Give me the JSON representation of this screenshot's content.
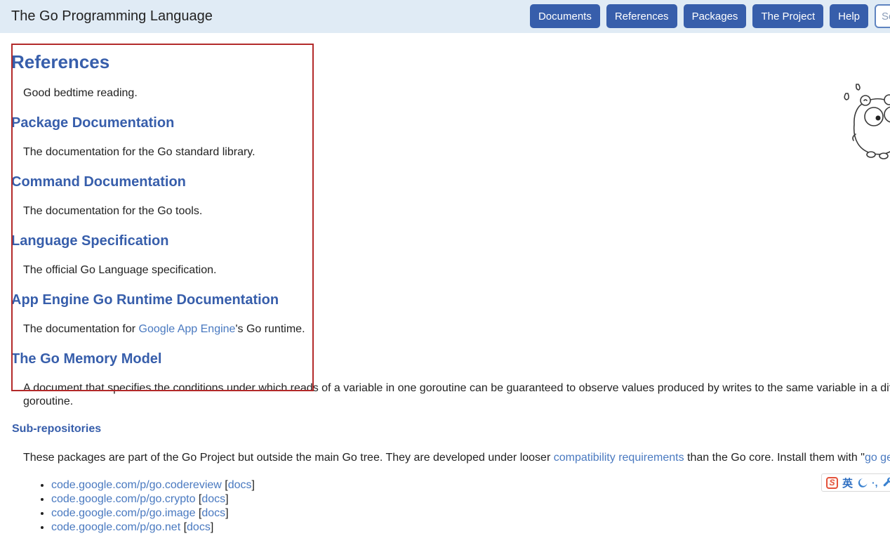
{
  "colors": {
    "accent_blue": "#375eab",
    "header_background": "#e0ebf5",
    "inline_link_blue": "#4979c0",
    "annotation_red": "#b32a2a",
    "ime_orange": "#e4533c",
    "ime_blue": "#2f6fc2"
  },
  "header": {
    "title": "The Go Programming Language",
    "nav": [
      {
        "label": "Documents"
      },
      {
        "label": "References"
      },
      {
        "label": "Packages"
      },
      {
        "label": "The Project"
      },
      {
        "label": "Help"
      }
    ],
    "search_placeholder": "Search"
  },
  "page": {
    "title": "References",
    "intro": "Good bedtime reading.",
    "sections": [
      {
        "heading": "Package Documentation",
        "desc": "The documentation for the Go standard library."
      },
      {
        "heading": "Command Documentation",
        "desc": "The documentation for the Go tools."
      },
      {
        "heading": "Language Specification",
        "desc": "The official Go Language specification."
      },
      {
        "heading": "App Engine Go Runtime Documentation",
        "desc_prefix": "The documentation for ",
        "desc_link": "Google App Engine",
        "desc_suffix": "'s Go runtime."
      },
      {
        "heading": "The Go Memory Model",
        "desc_line1": "A document that specifies the conditions under which reads of a variable in one goroutine can be guaranteed to observe values produced by writes to the same variable in a different",
        "desc_line2": "goroutine."
      }
    ],
    "subrepos": {
      "heading": "Sub-repositories",
      "intro_prefix": "These packages are part of the Go Project but outside the main Go tree. They are developed under looser ",
      "compat_link": "compatibility requirements",
      "intro_mid": " than the Go core. Install them with \"",
      "goget_link": "go get",
      "intro_suffix": "\".",
      "bracket_open": " [",
      "docs_label": "docs",
      "bracket_close": "]",
      "items": [
        {
          "url": "code.google.com/p/go.codereview"
        },
        {
          "url": "code.google.com/p/go.crypto"
        },
        {
          "url": "code.google.com/p/go.image"
        },
        {
          "url": "code.google.com/p/go.net"
        }
      ]
    }
  },
  "ime_bar": {
    "logo": "S",
    "lang": "英",
    "punct": "·,",
    "icons": [
      "sogou-logo-icon",
      "english-mode-label",
      "moon-icon",
      "punctuation-icon",
      "wrench-icon"
    ]
  }
}
